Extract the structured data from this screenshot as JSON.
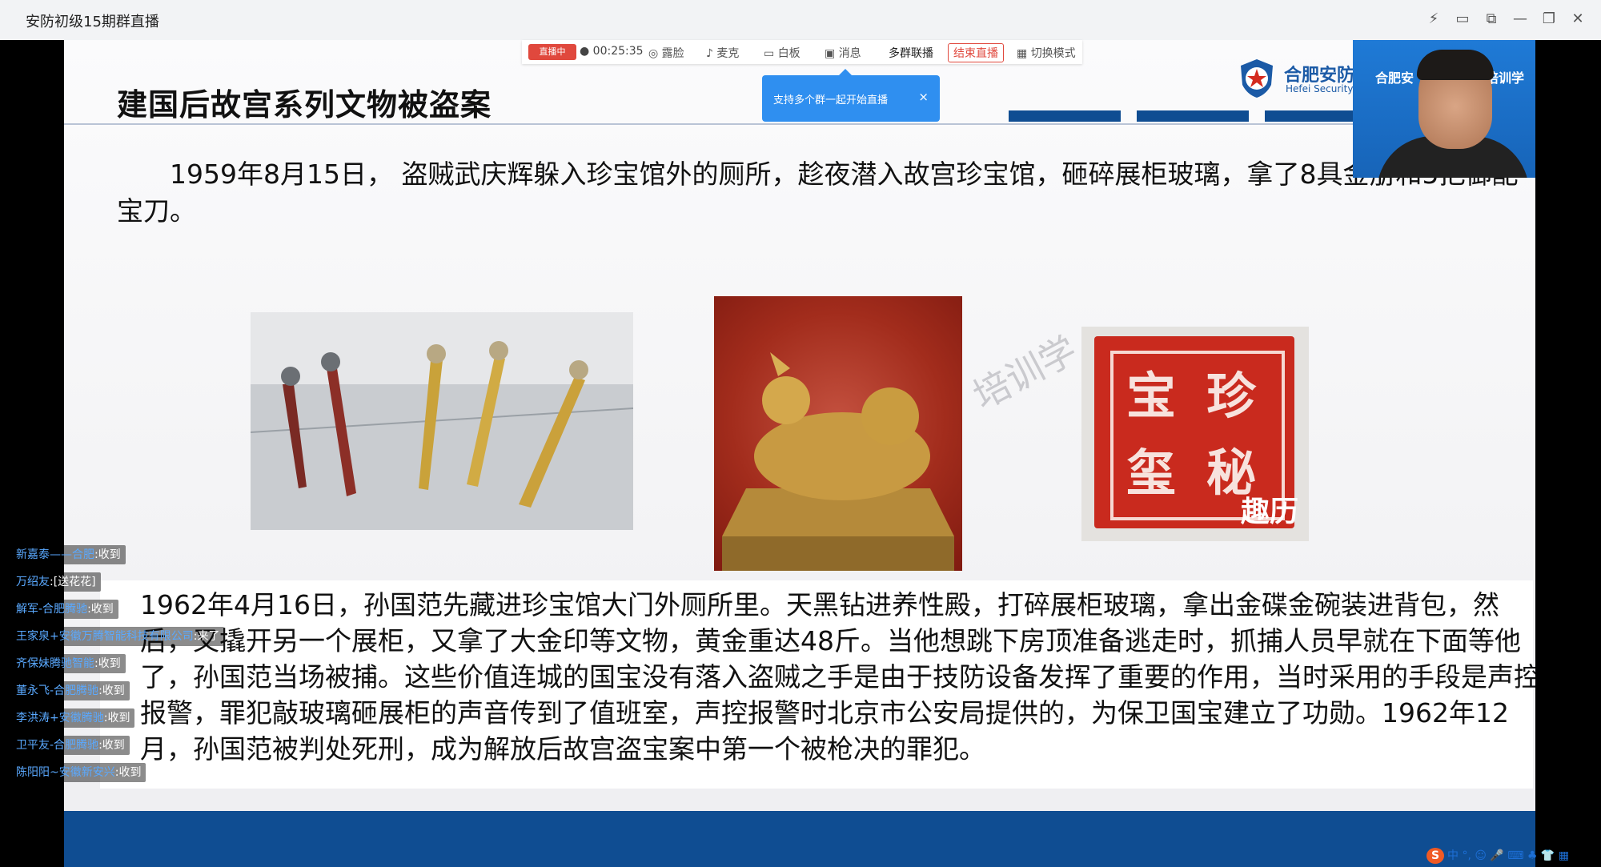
{
  "window": {
    "title": "安防初级15期群直播",
    "controls": [
      "⚡",
      "▭",
      "⧉",
      "—",
      "❐",
      "✕"
    ]
  },
  "toolbar": {
    "live_status": "直播中",
    "timer": "● 00:25:35",
    "items": [
      "露脸",
      "麦克",
      "白板",
      "消息",
      "多群联播"
    ],
    "end_button": "结束直播",
    "switch_mode": "切换模式",
    "tooltip_text": "支持多个群一起开始直播",
    "tooltip_close": "×"
  },
  "slide": {
    "title": "建国后故宫系列文物被盗案",
    "logo_text": "合肥安防",
    "logo_sub": "Hefei Security T",
    "paragraph1": "1959年8月15日， 盗贼武庆辉躲入珍宝馆外的厕所，趁夜潜入故宫珍宝馆，砸碎展柜玻璃，拿了8具金册和5把御配宝刀。",
    "watermark": "培训学",
    "photo3_mark": "趣历",
    "seal_chars": [
      "珍",
      "秘",
      "宝",
      "玺"
    ],
    "paragraph2": "1962年4月16日，孙国范先藏进珍宝馆大门外厕所里。天黑钻进养性殿，打碎展柜玻璃，拿出金碟金碗装进背包，然后，又撬开另一个展柜，又拿了大金印等文物，黄金重达48斤。当他想跳下房顶准备逃走时，抓捕人员早就在下面等他了，孙国范当场被捕。这些价值连城的国宝没有落入盗贼之手是由于技防设备发挥了重要的作用，当时采用的手段是声控报警，罪犯敲玻璃砸展柜的声音传到了值班室，声控报警时北京市公安局提供的，为保卫国宝建立了功勋。1962年12月，孙国范被判处死刑，成为解放后故宫盗宝案中第一个被枪决的罪犯。"
  },
  "webcam": {
    "banner_left": "合肥安",
    "banner_right": "业培训学校"
  },
  "danmaku": [
    {
      "name": "新嘉泰——合肥",
      "msg": ":收到"
    },
    {
      "name": "万绍友",
      "msg": ":[送花花]"
    },
    {
      "name": "解军-合肥腾驰",
      "msg": ":收到"
    },
    {
      "name": "王家泉+安徽万腾智能科技有限公司",
      "msg": ":来了"
    },
    {
      "name": "齐保妹腾驰智能",
      "msg": ":收到"
    },
    {
      "name": "董永飞-合肥腾驰",
      "msg": ":收到"
    },
    {
      "name": "李洪涛+安徽腾驰",
      "msg": ":收到"
    },
    {
      "name": "卫平友-合肥腾驰",
      "msg": ":收到"
    },
    {
      "name": "陈阳阳~安徽新安兴",
      "msg": ":收到"
    }
  ],
  "tray": {
    "logo": "S",
    "items": "中 °, ☺ 🎤 ⌨ ♣ 👕 ▦"
  },
  "colors": {
    "brand_blue": "#0f4d92",
    "live_red": "#e0483d",
    "tooltip_blue": "#2f8ff0",
    "seal_red": "#c92a1e"
  }
}
